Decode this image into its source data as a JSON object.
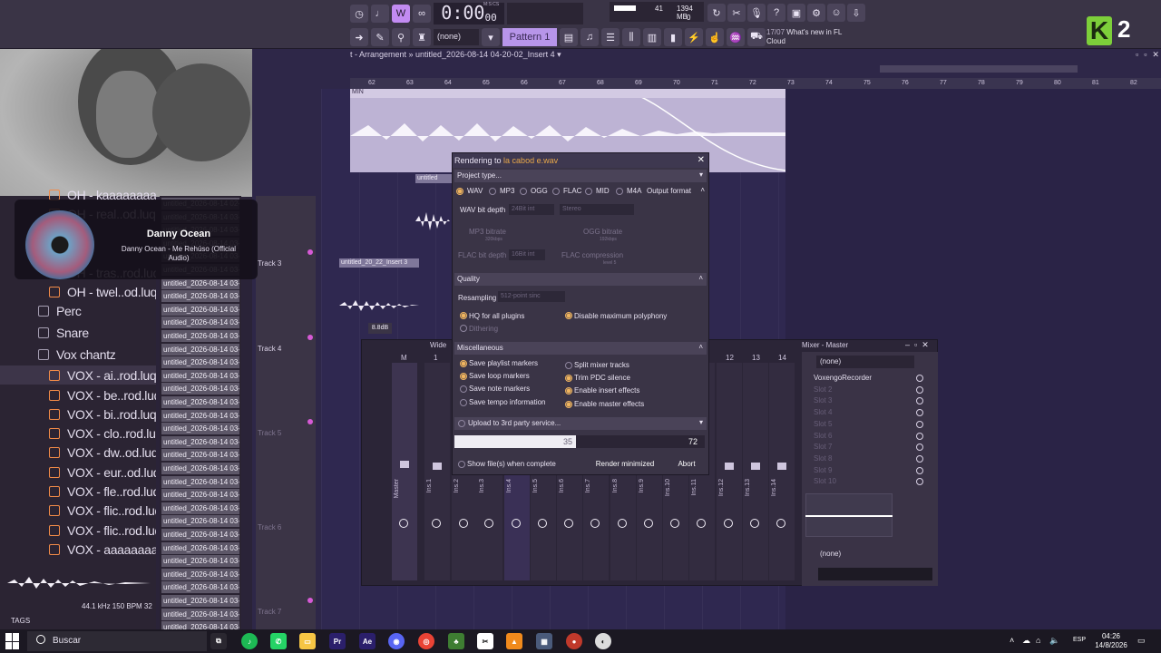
{
  "toolbar": {
    "time": "0:00",
    "time_frac": "00",
    "time_unit": "M:S:CS",
    "cpu": "41",
    "memory": "1394 MB",
    "polyphony": "0",
    "pattern_none": "(none)",
    "pattern": "Pattern 1",
    "news_date": "17/07",
    "news_text": "What's new in FL Cloud",
    "logo_letter": "K",
    "logo_number": "2"
  },
  "playlist": {
    "title": "t - Arrangement » untitled_2026-08-14 04-20-02_Insert 4 ▾",
    "ruler": [
      "62",
      "63",
      "64",
      "65",
      "66",
      "67",
      "68",
      "69",
      "70",
      "71",
      "72",
      "73",
      "74",
      "75",
      "76",
      "77",
      "78",
      "79",
      "80",
      "81",
      "82"
    ],
    "clips": {
      "top": "MIN",
      "clip2": "untitled",
      "clip3": "untitled_20_22_Insert 3"
    },
    "db_badge": "8.8dB",
    "tracks": [
      "Track 3",
      "Track 4",
      "Track 5",
      "Track 6",
      "Track 7"
    ]
  },
  "browser": {
    "items": [
      {
        "label": "OH - kaaaaaaaaaaa",
        "type": "file"
      },
      {
        "label": "OH - real..od.luqui",
        "type": "file"
      },
      {
        "label": "OH - tras..rod.luqui",
        "type": "file"
      },
      {
        "label": "OH - twel..od.luqui",
        "type": "file"
      },
      {
        "label": "Perc",
        "type": "folder"
      },
      {
        "label": "Snare",
        "type": "folder"
      },
      {
        "label": "Vox chantz",
        "type": "folder"
      },
      {
        "label": "VOX - ai..rod.luqui",
        "type": "file"
      },
      {
        "label": "VOX - be..rod.luqui",
        "type": "file"
      },
      {
        "label": "VOX - bi..rod.luqui",
        "type": "file"
      },
      {
        "label": "VOX - clo..rod.luqui",
        "type": "file"
      },
      {
        "label": "VOX - dw..od.luqui",
        "type": "file"
      },
      {
        "label": "VOX - eur..od.luqui",
        "type": "file"
      },
      {
        "label": "VOX - fle..rod.luqui",
        "type": "file"
      },
      {
        "label": "VOX - flic..rod.luqui",
        "type": "file"
      },
      {
        "label": "VOX - flic..rod.luqui",
        "type": "file"
      },
      {
        "label": "VOX - aaaaaaaaaa",
        "type": "file"
      }
    ],
    "preview_info": "44.1 kHz 150 BPM 32",
    "tags": "TAGS"
  },
  "now_playing": {
    "title": "Danny Ocean",
    "subtitle": "Danny Ocean - Me Rehúso (Official Audio)"
  },
  "files": {
    "first": "untitled_2026-08-14 02-",
    "rest": "untitled_2026-08-14 03-"
  },
  "mixer": {
    "title": "Mixer - Master",
    "wide": "Wide",
    "strip_master": "M",
    "strip_numbers": [
      "1",
      "2",
      "3",
      "4",
      "5",
      "6",
      "7",
      "8",
      "9",
      "10",
      "11",
      "12",
      "13",
      "14"
    ],
    "master_name": "Master",
    "insert_names": [
      "Ins.1",
      "Ins.2",
      "Ins.3",
      "Ins.4",
      "Ins.5",
      "Ins.6",
      "Ins.7",
      "Ins.8",
      "Ins.9",
      "Ins.10",
      "Ins.11",
      "Ins.12",
      "Ins.13",
      "Ins.14"
    ],
    "preset": "(none)",
    "slots": [
      "VoxengoRecorder",
      "Slot 2",
      "Slot 3",
      "Slot 4",
      "Slot 5",
      "Slot 6",
      "Slot 7",
      "Slot 8",
      "Slot 9",
      "Slot 10"
    ],
    "bottom_preset": "(none)"
  },
  "render": {
    "title_prefix": "Rendering to ",
    "file": "la cabod e.wav",
    "project_type": "Project type...",
    "formats": [
      "WAV",
      "MP3",
      "OGG",
      "FLAC",
      "MID",
      "M4A"
    ],
    "output_format": "Output format",
    "wav_bit_depth": "WAV bit depth",
    "wav_bit_val": "24Bit int",
    "stereo": "Stereo",
    "mp3_bitrate": "MP3 bitrate",
    "mp3_kbps": "320kbps",
    "ogg_bitrate": "OGG bitrate",
    "ogg_kbps": "192kbps",
    "flac_bit_depth": "FLAC bit depth",
    "flac_bit_val": "16Bit int",
    "flac_comp": "FLAC compression",
    "flac_level": "level 5",
    "quality": "Quality",
    "resampling": "Resampling",
    "resampling_val": "512-point sinc",
    "hq_plugins": "HQ for all plugins",
    "disable_poly": "Disable maximum polyphony",
    "dithering": "Dithering",
    "misc": "Miscellaneous",
    "misc_left": [
      "Save playlist markers",
      "Save loop markers",
      "Save note markers",
      "Save tempo information"
    ],
    "misc_right": [
      "Split mixer tracks",
      "Trim PDC silence",
      "Enable insert effects",
      "Enable master effects"
    ],
    "upload": "Upload to 3rd party service...",
    "progress": 35,
    "progress_total": 72,
    "show_files": "Show file(s) when complete",
    "render_min": "Render minimized",
    "abort": "Abort"
  },
  "taskbar": {
    "search": "Buscar",
    "lang": "ESP",
    "time": "04:26",
    "date": "14/8/2026"
  }
}
